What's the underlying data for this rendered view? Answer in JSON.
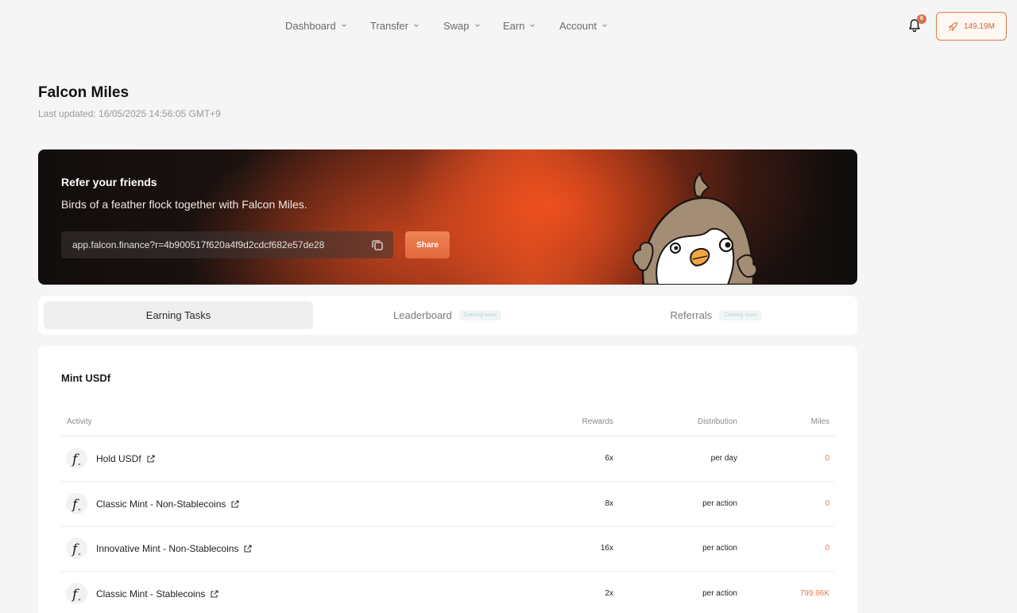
{
  "nav": {
    "items": [
      {
        "label": "Dashboard"
      },
      {
        "label": "Transfer"
      },
      {
        "label": "Swap"
      },
      {
        "label": "Earn"
      },
      {
        "label": "Account"
      }
    ],
    "notification_count": "6",
    "miles_balance": "149.19M",
    "accent_color": "#e0794d"
  },
  "header": {
    "title": "Falcon Miles",
    "last_updated": "Last updated: 16/05/2025 14:56:05 GMT+9"
  },
  "banner": {
    "title": "Refer your friends",
    "subtitle": "Birds of a feather flock together with Falcon Miles.",
    "referral_link": "app.falcon.finance?r=4b900517f620a4f9d2cdcf682e57de28",
    "share_label": "Share"
  },
  "tabs": [
    {
      "label": "Earning Tasks",
      "active": true
    },
    {
      "label": "Leaderboard",
      "badge": "Coming soon"
    },
    {
      "label": "Referrals",
      "badge": "Coming soon"
    }
  ],
  "section": {
    "title": "Mint USDf",
    "columns": {
      "activity": "Activity",
      "rewards": "Rewards",
      "distribution": "Distribution",
      "miles": "Miles"
    },
    "rows": [
      {
        "activity": "Hold USDf",
        "rewards": "6x",
        "distribution": "per day",
        "miles": "0"
      },
      {
        "activity": "Classic Mint - Non-Stablecoins",
        "rewards": "8x",
        "distribution": "per action",
        "miles": "0"
      },
      {
        "activity": "Innovative Mint - Non-Stablecoins",
        "rewards": "16x",
        "distribution": "per action",
        "miles": "0"
      },
      {
        "activity": "Classic Mint - Stablecoins",
        "rewards": "2x",
        "distribution": "per action",
        "miles": "799.96K"
      }
    ]
  }
}
